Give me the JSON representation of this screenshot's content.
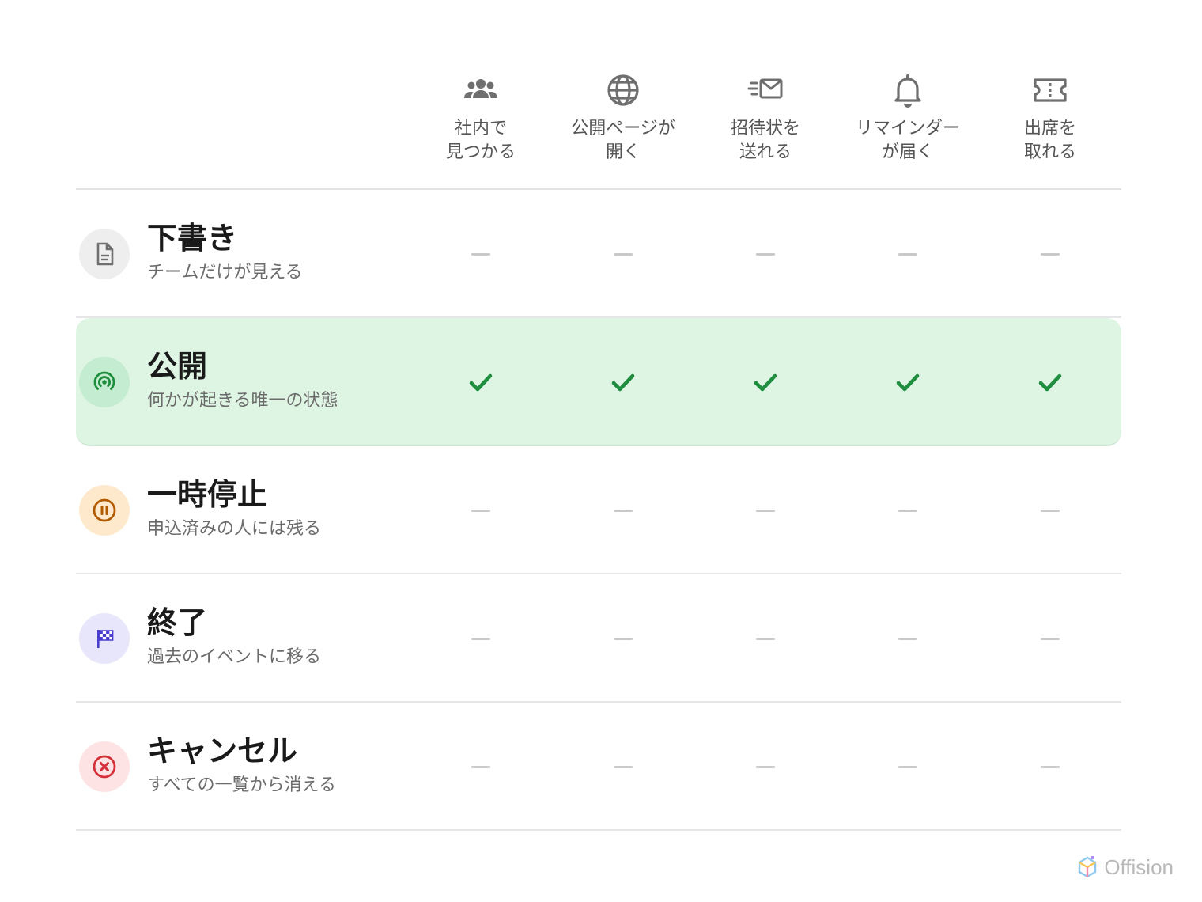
{
  "columns": [
    {
      "label": "社内で\n見つかる",
      "icon": "team-icon"
    },
    {
      "label": "公開ページが\n開く",
      "icon": "globe-icon"
    },
    {
      "label": "招待状を\n送れる",
      "icon": "send-mail-icon"
    },
    {
      "label": "リマインダー\nが届く",
      "icon": "bell-icon"
    },
    {
      "label": "出席を\n取れる",
      "icon": "ticket-icon"
    }
  ],
  "statuses": [
    {
      "title": "下書き",
      "subtitle": "チームだけが見える",
      "icon": "document-icon",
      "accent": "#6f6f6f",
      "bg": "#eeeeee",
      "cells": [
        false,
        false,
        false,
        false,
        false
      ]
    },
    {
      "title": "公開",
      "subtitle": "何かが起きる唯一の状態",
      "icon": "broadcast-icon",
      "accent": "#1e8e3e",
      "bg": "#c4ecd0",
      "cells": [
        true,
        true,
        true,
        true,
        true
      ]
    },
    {
      "title": "一時停止",
      "subtitle": "申込済みの人には残る",
      "icon": "pause-icon",
      "accent": "#b05a00",
      "bg": "#ffe9cc",
      "cells": [
        false,
        false,
        false,
        false,
        false
      ]
    },
    {
      "title": "終了",
      "subtitle": "過去のイベントに移る",
      "icon": "checkered-flag-icon",
      "accent": "#4a3fcf",
      "bg": "#e8e6fa",
      "cells": [
        false,
        false,
        false,
        false,
        false
      ]
    },
    {
      "title": "キャンセル",
      "subtitle": "すべての一覧から消える",
      "icon": "cancel-circle-icon",
      "accent": "#d3303a",
      "bg": "#fde3e3",
      "cells": [
        false,
        false,
        false,
        false,
        false
      ]
    }
  ],
  "colors": {
    "check": "#1e8e3e",
    "dash": "#c9c9c9",
    "active_row_bg": "#dff5e4"
  },
  "brand": {
    "name": "Offision",
    "icon": "offision-logo-icon"
  }
}
